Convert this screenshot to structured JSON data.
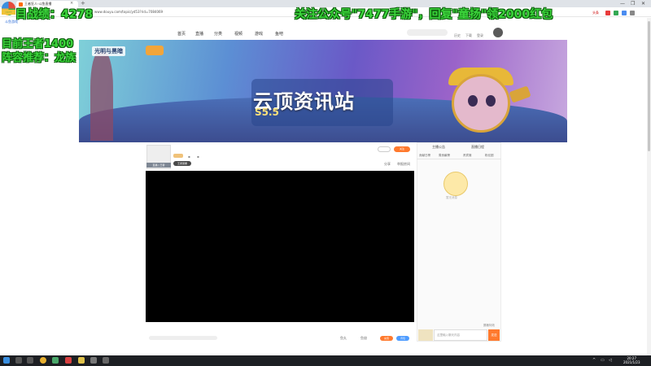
{
  "browser": {
    "tab_title": "王者狂人-斗鱼直播",
    "tab_close": "×",
    "new_tab": "+",
    "url": "www.douyu.com/topic/yd53?rid=7084069",
    "sidebar_app": "斗鱼游戏",
    "ext_label": "头条",
    "window_controls": [
      "—",
      "❐",
      "✕"
    ]
  },
  "site_nav": {
    "items": [
      "首页",
      "直播",
      "分类",
      "视频",
      "游戏",
      "鱼吧"
    ],
    "header_links": [
      "历史",
      "下载",
      "登录"
    ]
  },
  "banner": {
    "title": "云顶资讯站",
    "subtitle": "S5.5",
    "logo_text": "光明与黑暗",
    "icons": [
      "tree-icon",
      "penguin-hero-icon"
    ]
  },
  "room": {
    "badge": "直播 | 王者",
    "tag": "王者荣耀",
    "share": "分享",
    "report": "举报房间",
    "follow": "关注"
  },
  "gift_bar": {
    "option1": "鱼丸",
    "option2": "鱼翅",
    "pay": "充值",
    "charge": "背包"
  },
  "chat": {
    "top_tabs": [
      "主播公告",
      "直播日程"
    ],
    "tabs": [
      "贡献日榜",
      "周贡献榜",
      "贵宾席",
      "粉丝团"
    ],
    "empty": "暂无消息",
    "check": "屏蔽特效",
    "input_placeholder": "这里输入聊天内容",
    "send": "发送"
  },
  "taskbar": {
    "time": "20:27",
    "date": "2021/1/23"
  },
  "overlay": {
    "score_label": "目战绩：4278",
    "promo": "关注公众号\"7477手游\"，回复\"童扬\"领2000红包",
    "king": "目前王者1400",
    "lineup": "阵容推荐：龙族",
    "logo_label": "7477"
  },
  "colors": {
    "accent_orange": "#ff7a2e",
    "overlay_green": "#3bd43b",
    "link_blue": "#4e9cff"
  }
}
